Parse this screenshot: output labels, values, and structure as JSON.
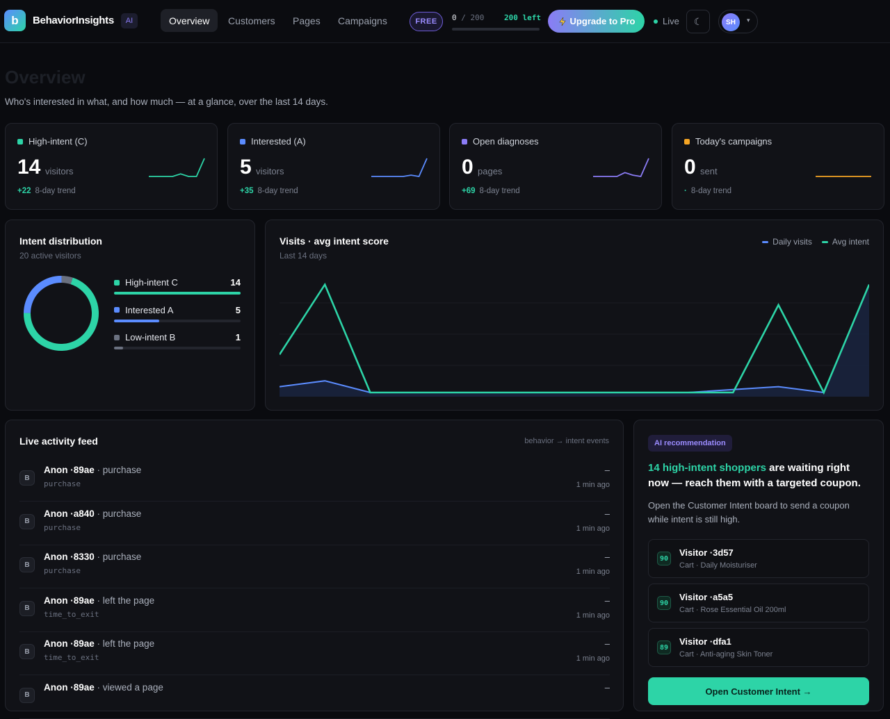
{
  "nav": {
    "logo_letter": "b",
    "brand": "BehaviorInsights",
    "ai_badge": "AI",
    "tabs": [
      {
        "label": "Overview",
        "active": true
      },
      {
        "label": "Customers",
        "active": false
      },
      {
        "label": "Pages",
        "active": false
      },
      {
        "label": "Campaigns",
        "active": false
      }
    ],
    "plan_badge": "FREE",
    "quota_used": "0",
    "quota_sep": "/ 200",
    "quota_left": "200 left",
    "quota_fraction": 0,
    "upgrade_label": "Upgrade to Pro",
    "upgrade_icon": "lightning-icon",
    "live_label": "Live",
    "theme_icon": "moon-icon",
    "theme_glyph": "☾",
    "avatar_initials": "SH",
    "user_chevron": "▾"
  },
  "page": {
    "title": "Overview",
    "subtitle": "Who's interested in what, and how much — at a glance, over the last 14 days."
  },
  "kpis": [
    {
      "label": "High-intent (C)",
      "value": "14",
      "unit": "visitors",
      "delta": "+22",
      "foot": "8-day trend",
      "color": "#2dd4a7",
      "spark": [
        0,
        0,
        0,
        0,
        2,
        0,
        0,
        14
      ]
    },
    {
      "label": "Interested (A)",
      "value": "5",
      "unit": "visitors",
      "delta": "+35",
      "foot": "8-day trend",
      "color": "#5b8cff",
      "spark": [
        0,
        0,
        0,
        0,
        0,
        1,
        0,
        14
      ]
    },
    {
      "label": "Open diagnoses",
      "value": "0",
      "unit": "pages",
      "delta": "+69",
      "foot": "8-day trend",
      "color": "#8b7cf6",
      "spark": [
        0,
        0,
        0,
        0,
        3,
        1,
        0,
        14
      ]
    },
    {
      "label": "Today's campaigns",
      "value": "0",
      "unit": "sent",
      "delta": "·",
      "foot": "8-day trend",
      "color": "#f5a524",
      "spark": [
        0,
        0,
        0,
        0,
        0,
        0,
        0,
        0
      ]
    }
  ],
  "distribution": {
    "title": "Intent distribution",
    "subtitle": "20 active visitors",
    "segments": [
      {
        "label": "High-intent C",
        "count": 14,
        "count_text": "14",
        "color": "#2dd4a7"
      },
      {
        "label": "Interested A",
        "count": 5,
        "count_text": "5",
        "color": "#5b8cff"
      },
      {
        "label": "Low-intent B",
        "count": 1,
        "count_text": "1",
        "color": "#6b7180"
      }
    ],
    "total": 20
  },
  "visits_chart": {
    "title": "Visits · avg intent score",
    "subtitle": "Last 14 days",
    "legend": [
      {
        "name": "Daily visits",
        "color": "#5b8cff"
      },
      {
        "name": "Avg intent",
        "color": "#2dd4a7"
      }
    ]
  },
  "chart_data": {
    "type": "line",
    "x": [
      1,
      2,
      3,
      4,
      5,
      6,
      7,
      8,
      9,
      10,
      11,
      12,
      13,
      14
    ],
    "series": [
      {
        "name": "Daily visits",
        "values": [
          2,
          4,
          0,
          0,
          0,
          0,
          0,
          0,
          0,
          0,
          1,
          2,
          0,
          37
        ]
      },
      {
        "name": "Avg intent",
        "values": [
          13,
          37,
          0,
          0,
          0,
          0,
          0,
          0,
          0,
          0,
          0,
          30,
          0,
          37
        ]
      }
    ],
    "ylim": [
      0,
      40
    ],
    "grid": true,
    "legend_position": "top-right"
  },
  "feed": {
    "title": "Live activity feed",
    "header_note": "behavior → intent events",
    "items": [
      {
        "badge": "B",
        "user": "Anon ·89ae",
        "action": " · purchase",
        "code": "purchase",
        "dash": "–",
        "time": "1 min ago"
      },
      {
        "badge": "B",
        "user": "Anon ·a840",
        "action": " · purchase",
        "code": "purchase",
        "dash": "–",
        "time": "1 min ago"
      },
      {
        "badge": "B",
        "user": "Anon ·8330",
        "action": " · purchase",
        "code": "purchase",
        "dash": "–",
        "time": "1 min ago"
      },
      {
        "badge": "B",
        "user": "Anon ·89ae",
        "action": " · left the page",
        "code": "time_to_exit",
        "dash": "–",
        "time": "1 min ago"
      },
      {
        "badge": "B",
        "user": "Anon ·89ae",
        "action": " · left the page",
        "code": "time_to_exit",
        "dash": "–",
        "time": "1 min ago"
      },
      {
        "badge": "B",
        "user": "Anon ·89ae",
        "action": " · viewed a page",
        "code": "",
        "dash": "–",
        "time": ""
      }
    ]
  },
  "ai": {
    "badge": "AI recommendation",
    "headline_highlight": "14 high-intent shoppers",
    "headline_rest": " are waiting right now — reach them with a targeted coupon.",
    "body": "Open the Customer Intent board to send a coupon while intent is still high.",
    "visitors": [
      {
        "score": "90",
        "name": "Visitor ·3d57",
        "detail": "Cart · Daily Moisturiser"
      },
      {
        "score": "90",
        "name": "Visitor ·a5a5",
        "detail": "Cart · Rose Essential Oil 200ml"
      },
      {
        "score": "89",
        "name": "Visitor ·dfa1",
        "detail": "Cart · Anti-aging Skin Toner"
      }
    ],
    "cta": "Open Customer Intent →"
  }
}
